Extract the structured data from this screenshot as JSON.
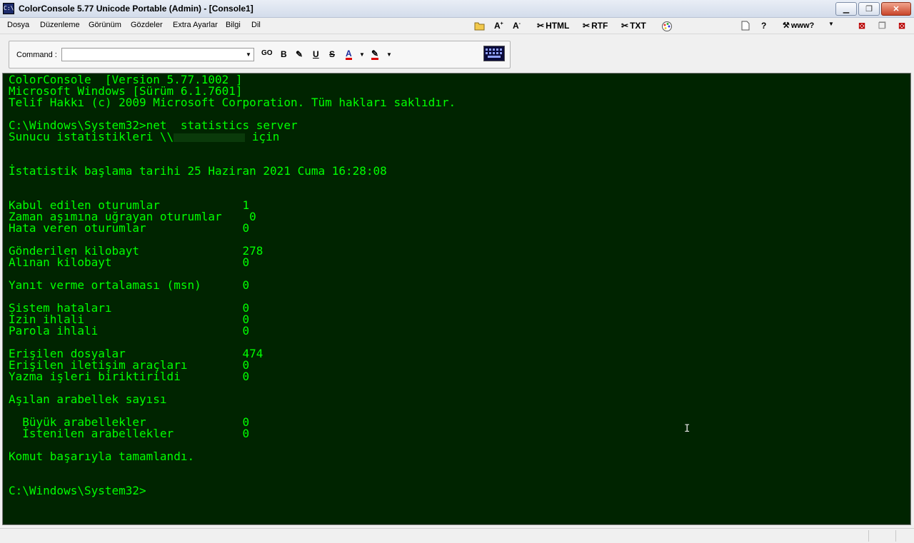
{
  "window": {
    "title": "ColorConsole 5.77 Unicode Portable (Admin) - [Console1]",
    "icon_text": "C:\\"
  },
  "menubar": {
    "items": [
      "Dosya",
      "Düzenleme",
      "Görünüm",
      "Gözdeler",
      "Extra Ayarlar",
      "Bilgi",
      "Dil"
    ],
    "export_html": "HTML",
    "export_rtf": "RTF",
    "export_txt": "TXT",
    "help": "?",
    "www": "www?"
  },
  "command_bar": {
    "label": "Command :",
    "value": "",
    "go": "GO",
    "bold": "B",
    "underline": "U",
    "strike": "S",
    "font_color": "A"
  },
  "console": {
    "colors": {
      "background": "#002400",
      "text": "#00ff00"
    },
    "lines": [
      "ColorConsole  [Version 5.77.1002 ]",
      "Microsoft Windows [Sürüm 6.1.7601]",
      "Telif Hakkı (c) 2009 Microsoft Corporation. Tüm hakları saklıdır.",
      "",
      "C:\\Windows\\System32>net  statistics server",
      "",
      "",
      "",
      "İstatistik başlama tarihi 25 Haziran 2021 Cuma 16:28:08",
      "",
      "",
      "Kabul edilen oturumlar            1",
      "Zaman aşımına uğrayan oturumlar    0",
      "Hata veren oturumlar              0",
      "",
      "Gönderilen kilobayt               278",
      "Alınan kilobayt                   0",
      "",
      "Yanıt verme ortalaması (msn)      0",
      "",
      "Sistem hataları                   0",
      "İzin ihlali                       0",
      "Parola ihlali                     0",
      "",
      "Erişilen dosyalar                 474",
      "Erişilen iletişim araçları        0",
      "Yazma işleri biriktirildi         0",
      "",
      "Aşılan arabellek sayısı",
      "",
      "  Büyük arabellekler              0",
      "  İstenilen arabellekler          0",
      "",
      "Komut başarıyla tamamlandı.",
      "",
      "",
      "C:\\Windows\\System32>"
    ],
    "redacted_line": {
      "prefix": "Sunucu istatistikleri \\\\",
      "suffix": " için"
    }
  }
}
